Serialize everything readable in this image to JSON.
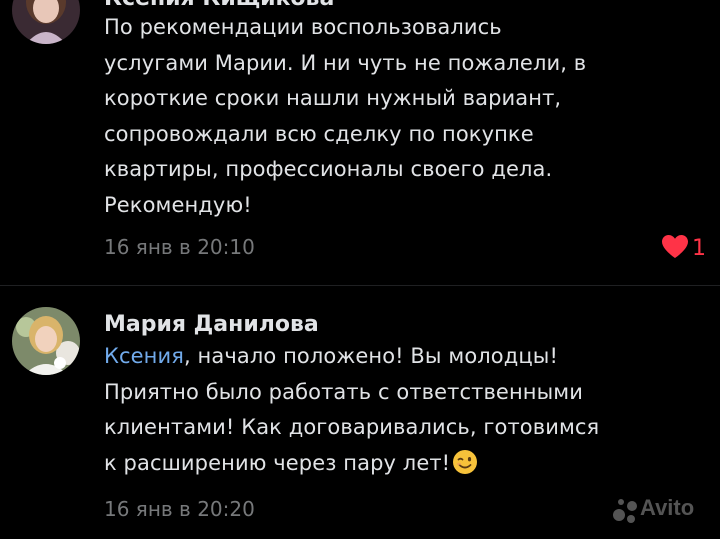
{
  "comments": [
    {
      "author": "Ксения Кищикова",
      "text_lines": [
        "По рекомендации воспользовались",
        "услугами Марии. И ни чуть не пожалели, в",
        "короткие сроки нашли нужный вариант,",
        "сопровождали всю сделку по покупке",
        "квартиры, профессионалы своего дела.",
        "Рекомендую!"
      ],
      "timestamp": "16 янв в 20:10",
      "likes": "1",
      "like_icon": "heart-icon"
    },
    {
      "author": "Мария Данилова",
      "mention": "Ксения",
      "text_line_1_rest": ", начало положено! Вы молодцы!",
      "text_lines": [
        "Приятно было работать с ответственными",
        "клиентами! Как договаривались, готовимся",
        "к расширению через пару лет!"
      ],
      "emoji": "winking-face-emoji",
      "timestamp": "16 янв в 20:20"
    }
  ],
  "watermark": "Avito",
  "colors": {
    "background": "#000000",
    "text": "#e1e3e6",
    "secondary": "#76787a",
    "mention": "#71aaeb",
    "like": "#ff3347"
  }
}
